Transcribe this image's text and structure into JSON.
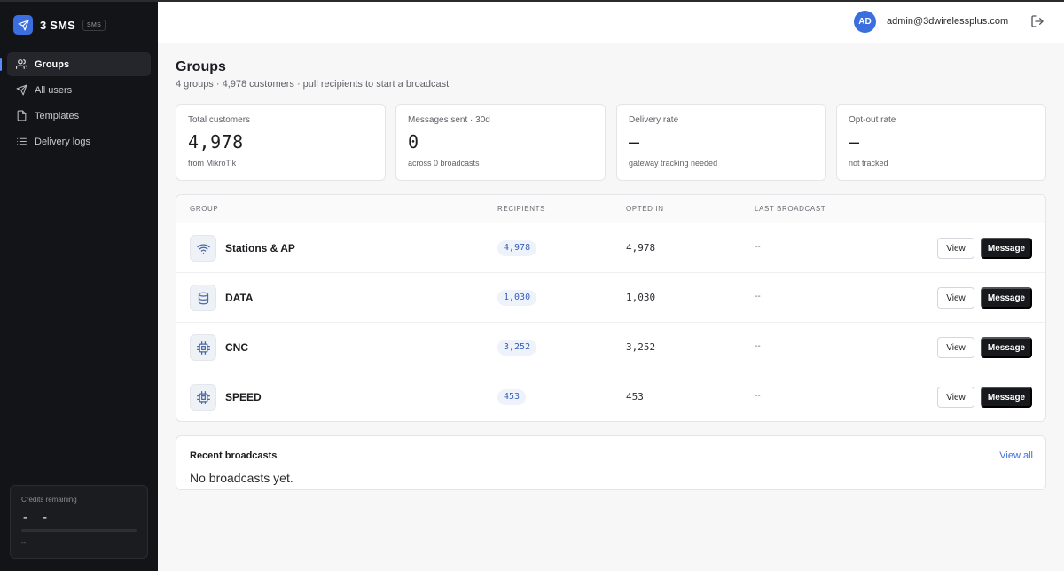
{
  "app": {
    "name": "3 SMS",
    "badge": "SMS"
  },
  "sidebar": {
    "items": [
      {
        "label": "Groups",
        "icon": "users-icon",
        "active": true
      },
      {
        "label": "All users",
        "icon": "send-icon",
        "active": false
      },
      {
        "label": "Templates",
        "icon": "file-icon",
        "active": false
      },
      {
        "label": "Delivery logs",
        "icon": "list-icon",
        "active": false
      }
    ],
    "credits": {
      "label": "Credits remaining",
      "value": "- -",
      "sub": "--",
      "fill_fraction": 0
    }
  },
  "header": {
    "avatar_initials": "AD",
    "email": "admin@3dwirelessplus.com"
  },
  "page": {
    "title": "Groups",
    "subtitle": "4 groups · 4,978 customers · pull recipients to start a broadcast"
  },
  "stats": [
    {
      "label": "Total customers",
      "value": "4,978",
      "foot": "from MikroTik"
    },
    {
      "label": "Messages sent · 30d",
      "value": "0",
      "foot": "across 0 broadcasts"
    },
    {
      "label": "Delivery rate",
      "value": "—",
      "foot": "gateway tracking needed"
    },
    {
      "label": "Opt-out rate",
      "value": "—",
      "foot": "not tracked"
    }
  ],
  "table": {
    "headers": [
      "Group",
      "Recipients",
      "Opted in",
      "Last broadcast"
    ],
    "view_label": "View",
    "message_label": "Message",
    "rows": [
      {
        "name": "Stations & AP",
        "icon": "wifi-icon",
        "recipients": "4,978",
        "opted_in": "4,978",
        "last": "--"
      },
      {
        "name": "DATA",
        "icon": "database-icon",
        "recipients": "1,030",
        "opted_in": "1,030",
        "last": "--"
      },
      {
        "name": "CNC",
        "icon": "cpu-icon",
        "recipients": "3,252",
        "opted_in": "3,252",
        "last": "--"
      },
      {
        "name": "SPEED",
        "icon": "cpu-icon",
        "recipients": "453",
        "opted_in": "453",
        "last": "--"
      }
    ]
  },
  "recent": {
    "title": "Recent broadcasts",
    "view_all": "View all",
    "empty": "No broadcasts yet."
  }
}
